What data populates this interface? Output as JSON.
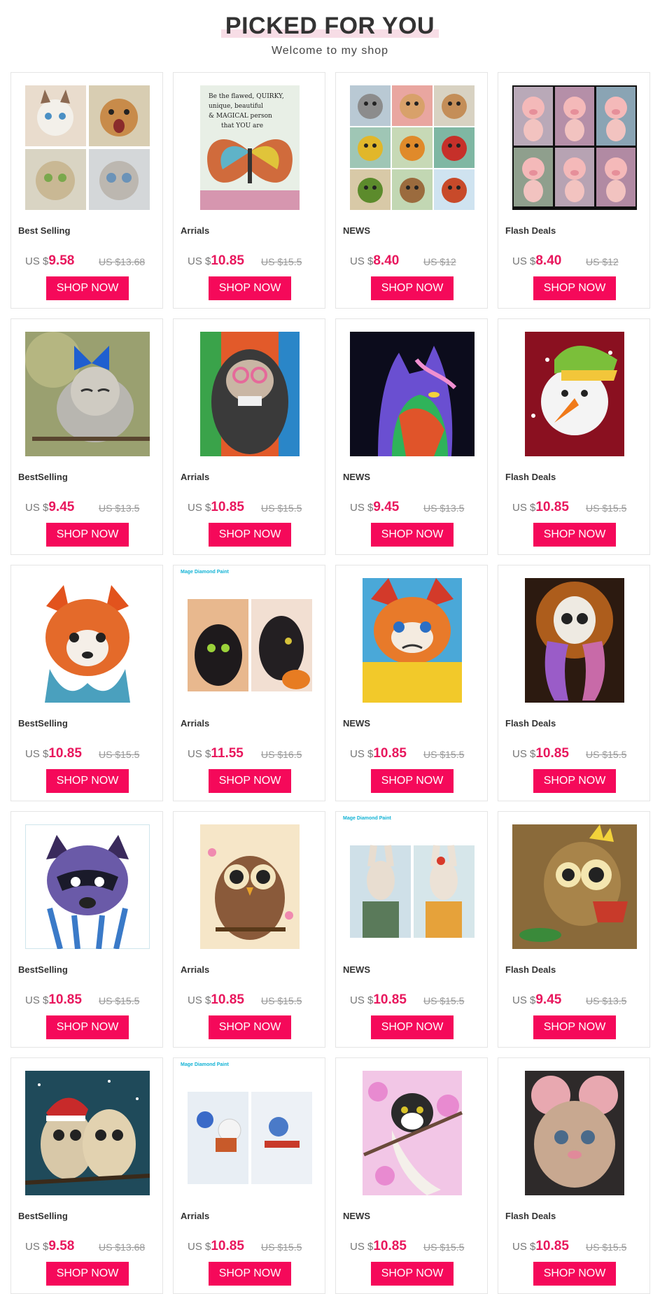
{
  "header": {
    "title": "PICKED FOR YOU",
    "subtitle": "Welcome to my shop"
  },
  "currency_prefix": "US $",
  "button_label": "SHOP NOW",
  "colors": {
    "accent": "#f5095a",
    "price": "#e8175d",
    "title_highlight": "#f7dde6"
  },
  "products": [
    {
      "category": "Best Selling",
      "price": "9.58",
      "old_price": "US $13.68",
      "image": "four-cats-portraits"
    },
    {
      "category": "Arrials",
      "price": "10.85",
      "old_price": "US $15.5",
      "image": "butterfly-quote-art",
      "art_text": "Be the flawed, QUIRKY, unique, beautiful & MAGICAL person that YOU are"
    },
    {
      "category": "NEWS",
      "price": "8.40",
      "old_price": "US $12",
      "image": "nine-animal-grid"
    },
    {
      "category": "Flash Deals",
      "price": "8.40",
      "old_price": "US $12",
      "image": "six-pigs-grid"
    },
    {
      "category": "BestSelling",
      "price": "9.45",
      "old_price": "US $13.5",
      "image": "owl-with-butterfly"
    },
    {
      "category": "Arrials",
      "price": "10.85",
      "old_price": "US $15.5",
      "image": "monkey-glasses"
    },
    {
      "category": "NEWS",
      "price": "9.45",
      "old_price": "US $13.5",
      "image": "rainbow-cat"
    },
    {
      "category": "Flash Deals",
      "price": "10.85",
      "old_price": "US $15.5",
      "image": "snowman"
    },
    {
      "category": "BestSelling",
      "price": "10.85",
      "old_price": "US $15.5",
      "image": "red-panda-watercolor"
    },
    {
      "category": "Arrials",
      "price": "11.55",
      "old_price": "US $16.5",
      "image": "black-cats-pumpkin",
      "brand": "Mage Diamond Paint"
    },
    {
      "category": "NEWS",
      "price": "10.85",
      "old_price": "US $15.5",
      "image": "grumpy-cat"
    },
    {
      "category": "Flash Deals",
      "price": "10.85",
      "old_price": "US $15.5",
      "image": "skull-dreamcatcher"
    },
    {
      "category": "BestSelling",
      "price": "10.85",
      "old_price": "US $15.5",
      "image": "raccoon-watercolor"
    },
    {
      "category": "Arrials",
      "price": "10.85",
      "old_price": "US $15.5",
      "image": "brown-owl"
    },
    {
      "category": "NEWS",
      "price": "10.85",
      "old_price": "US $15.5",
      "image": "rabbits-pair",
      "brand": "Mage Diamond Paint"
    },
    {
      "category": "Flash Deals",
      "price": "9.45",
      "old_price": "US $13.5",
      "image": "owl-king-teacup"
    },
    {
      "category": "BestSelling",
      "price": "9.58",
      "old_price": "US $13.68",
      "image": "christmas-owls"
    },
    {
      "category": "Arrials",
      "price": "10.85",
      "old_price": "US $15.5",
      "image": "winter-cats-sled",
      "brand": "Mage Diamond Paint"
    },
    {
      "category": "NEWS",
      "price": "10.85",
      "old_price": "US $15.5",
      "image": "cat-cherry-blossom"
    },
    {
      "category": "Flash Deals",
      "price": "10.85",
      "old_price": "US $15.5",
      "image": "pink-mouse"
    }
  ]
}
